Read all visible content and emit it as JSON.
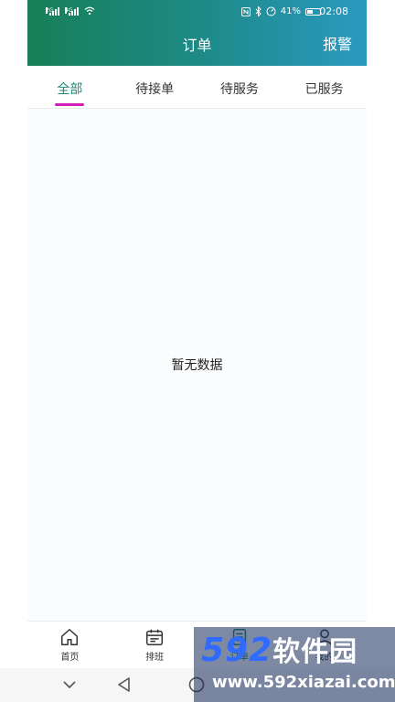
{
  "status_bar": {
    "sim1": "2G",
    "sim2": "4G",
    "battery": "41%",
    "time": "02:08"
  },
  "header": {
    "title": "订单",
    "alarm_label": "报警"
  },
  "tabs": [
    {
      "label": "全部",
      "active": true
    },
    {
      "label": "待接单",
      "active": false
    },
    {
      "label": "待服务",
      "active": false
    },
    {
      "label": "已服务",
      "active": false
    }
  ],
  "content": {
    "empty_text": "暂无数据"
  },
  "bottom_nav": [
    {
      "label": "首页",
      "icon": "home-icon"
    },
    {
      "label": "排班",
      "icon": "calendar-icon"
    },
    {
      "label": "订单",
      "icon": "document-icon"
    },
    {
      "label": "我的",
      "icon": "user-icon"
    }
  ],
  "watermark": {
    "logo_num": "592",
    "logo_cn": "软件园",
    "url": "www.592xiazai.com"
  },
  "colors": {
    "accent": "#1d8a72",
    "indicator": "#d21fb9",
    "header_start": "#187f56",
    "header_end": "#2b99c0"
  }
}
